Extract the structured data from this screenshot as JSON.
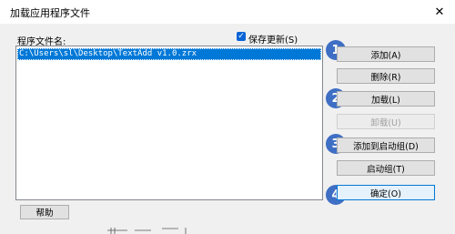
{
  "window": {
    "title": "加载应用程序文件",
    "close_glyph": "✕"
  },
  "list": {
    "label": "程序文件名:",
    "items": [
      "C:\\Users\\sl\\Desktop\\TextAdd v1.0.zrx"
    ]
  },
  "save_changes": {
    "label": "保存更新(S)",
    "checked": true,
    "check_glyph": "✓"
  },
  "buttons": {
    "add": "添加(A)",
    "remove": "删除(R)",
    "load": "加载(L)",
    "unload": "卸载(U)",
    "add_startup": "添加到启动组(D)",
    "startup_group": "启动组(T)",
    "ok": "确定(O)",
    "help": "帮助"
  },
  "badges": [
    "1",
    "2",
    "3",
    "4"
  ],
  "colors": {
    "badge": "#3f6fc4",
    "selection": "#0078d7",
    "checkbox": "#0a64d6"
  }
}
